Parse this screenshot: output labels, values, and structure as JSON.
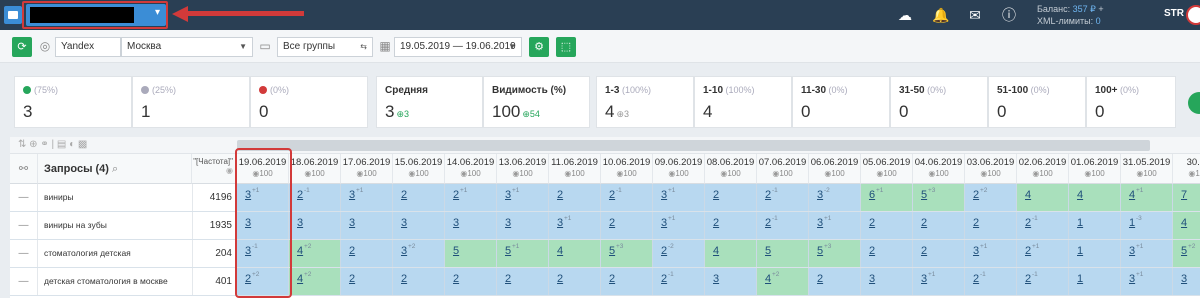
{
  "topbar": {
    "balance_label": "Баланс:",
    "balance_value": "357 ₽",
    "xml_label": "XML-лимиты:",
    "xml_value": "0",
    "user": "STR"
  },
  "toolbar": {
    "engine": "Yandex",
    "region": "Москва",
    "groups": "Все группы",
    "date_range": "19.05.2019 — 19.06.2019"
  },
  "stats": [
    {
      "label": "(75%)",
      "value": "3",
      "dot": "#26a65b"
    },
    {
      "label": "(25%)",
      "value": "1",
      "dot": "#aab"
    },
    {
      "label": "(0%)",
      "value": "0",
      "dot": "#d23a3a"
    },
    {
      "label": "Средняя",
      "value": "3",
      "delta": "3"
    },
    {
      "label": "Видимость (%)",
      "value": "100",
      "delta": "54"
    },
    {
      "label": "1-3",
      "sub": "(100%)",
      "value": "4",
      "delta": "3"
    },
    {
      "label": "1-10",
      "sub": "(100%)",
      "value": "4"
    },
    {
      "label": "11-30",
      "sub": "(0%)",
      "value": "0"
    },
    {
      "label": "31-50",
      "sub": "(0%)",
      "value": "0"
    },
    {
      "label": "51-100",
      "sub": "(0%)",
      "value": "0"
    },
    {
      "label": "100+",
      "sub": "(0%)",
      "value": "0"
    }
  ],
  "table": {
    "queries_label": "Запросы (4)",
    "freq_label": "\"[Частота]\"",
    "dates": [
      "19.06.2019",
      "18.06.2019",
      "17.06.2019",
      "15.06.2019",
      "14.06.2019",
      "13.06.2019",
      "11.06.2019",
      "10.06.2019",
      "09.06.2019",
      "08.06.2019",
      "07.06.2019",
      "06.06.2019",
      "05.06.2019",
      "04.06.2019",
      "03.06.2019",
      "02.06.2019",
      "01.06.2019",
      "31.05.2019",
      "30.05"
    ],
    "date_sub": "100",
    "rows": [
      {
        "query": "виниры",
        "freq": "4196",
        "cells": [
          [
            "3",
            "+1",
            "b"
          ],
          [
            "2",
            "-1",
            "b"
          ],
          [
            "3",
            "+1",
            "b"
          ],
          [
            "2",
            "",
            "b"
          ],
          [
            "2",
            "+1",
            "b"
          ],
          [
            "3",
            "+1",
            "b"
          ],
          [
            "2",
            "",
            "b"
          ],
          [
            "2",
            "-1",
            "b"
          ],
          [
            "3",
            "+1",
            "b"
          ],
          [
            "2",
            "",
            "b"
          ],
          [
            "2",
            "-1",
            "b"
          ],
          [
            "3",
            "-2",
            "b"
          ],
          [
            "6",
            "+1",
            "g"
          ],
          [
            "5",
            "+3",
            "g"
          ],
          [
            "2",
            "+2",
            "b"
          ],
          [
            "4",
            "",
            "g"
          ],
          [
            "4",
            "",
            "g"
          ],
          [
            "4",
            "+1",
            "g"
          ],
          [
            "7",
            "",
            "g"
          ]
        ]
      },
      {
        "query": "виниры на зубы",
        "freq": "1935",
        "cells": [
          [
            "3",
            "",
            "b"
          ],
          [
            "3",
            "",
            "b"
          ],
          [
            "3",
            "",
            "b"
          ],
          [
            "3",
            "",
            "b"
          ],
          [
            "3",
            "",
            "b"
          ],
          [
            "3",
            "",
            "b"
          ],
          [
            "3",
            "+1",
            "b"
          ],
          [
            "2",
            "",
            "b"
          ],
          [
            "3",
            "+1",
            "b"
          ],
          [
            "2",
            "",
            "b"
          ],
          [
            "2",
            "-1",
            "b"
          ],
          [
            "3",
            "+1",
            "b"
          ],
          [
            "2",
            "",
            "b"
          ],
          [
            "2",
            "",
            "b"
          ],
          [
            "2",
            "",
            "b"
          ],
          [
            "2",
            "-1",
            "b"
          ],
          [
            "1",
            "",
            "b"
          ],
          [
            "1",
            "-3",
            "b"
          ],
          [
            "4",
            "",
            "g"
          ]
        ]
      },
      {
        "query": "стоматология детская",
        "freq": "204",
        "cells": [
          [
            "3",
            "-1",
            "b"
          ],
          [
            "4",
            "+2",
            "g"
          ],
          [
            "2",
            "",
            "b"
          ],
          [
            "3",
            "+2",
            "b"
          ],
          [
            "5",
            "",
            "g"
          ],
          [
            "5",
            "+1",
            "g"
          ],
          [
            "4",
            "",
            "g"
          ],
          [
            "5",
            "+3",
            "g"
          ],
          [
            "2",
            "-2",
            "b"
          ],
          [
            "4",
            "",
            "g"
          ],
          [
            "5",
            "",
            "g"
          ],
          [
            "5",
            "+3",
            "g"
          ],
          [
            "2",
            "",
            "b"
          ],
          [
            "2",
            "",
            "b"
          ],
          [
            "3",
            "+1",
            "b"
          ],
          [
            "2",
            "+1",
            "b"
          ],
          [
            "1",
            "",
            "b"
          ],
          [
            "3",
            "+1",
            "b"
          ],
          [
            "5",
            "+2",
            "g"
          ]
        ]
      },
      {
        "query": "детская стоматология в москве",
        "freq": "401",
        "cells": [
          [
            "2",
            "+2",
            "b"
          ],
          [
            "4",
            "+2",
            "g"
          ],
          [
            "2",
            "",
            "b"
          ],
          [
            "2",
            "",
            "b"
          ],
          [
            "2",
            "",
            "b"
          ],
          [
            "2",
            "",
            "b"
          ],
          [
            "2",
            "",
            "b"
          ],
          [
            "2",
            "",
            "b"
          ],
          [
            "2",
            "-1",
            "b"
          ],
          [
            "3",
            "",
            "b"
          ],
          [
            "4",
            "+2",
            "g"
          ],
          [
            "2",
            "",
            "b"
          ],
          [
            "3",
            "",
            "b"
          ],
          [
            "3",
            "+1",
            "b"
          ],
          [
            "2",
            "-1",
            "b"
          ],
          [
            "2",
            "-1",
            "b"
          ],
          [
            "1",
            "",
            "b"
          ],
          [
            "3",
            "+1",
            "b"
          ],
          [
            "3",
            "",
            "b"
          ]
        ]
      }
    ]
  }
}
